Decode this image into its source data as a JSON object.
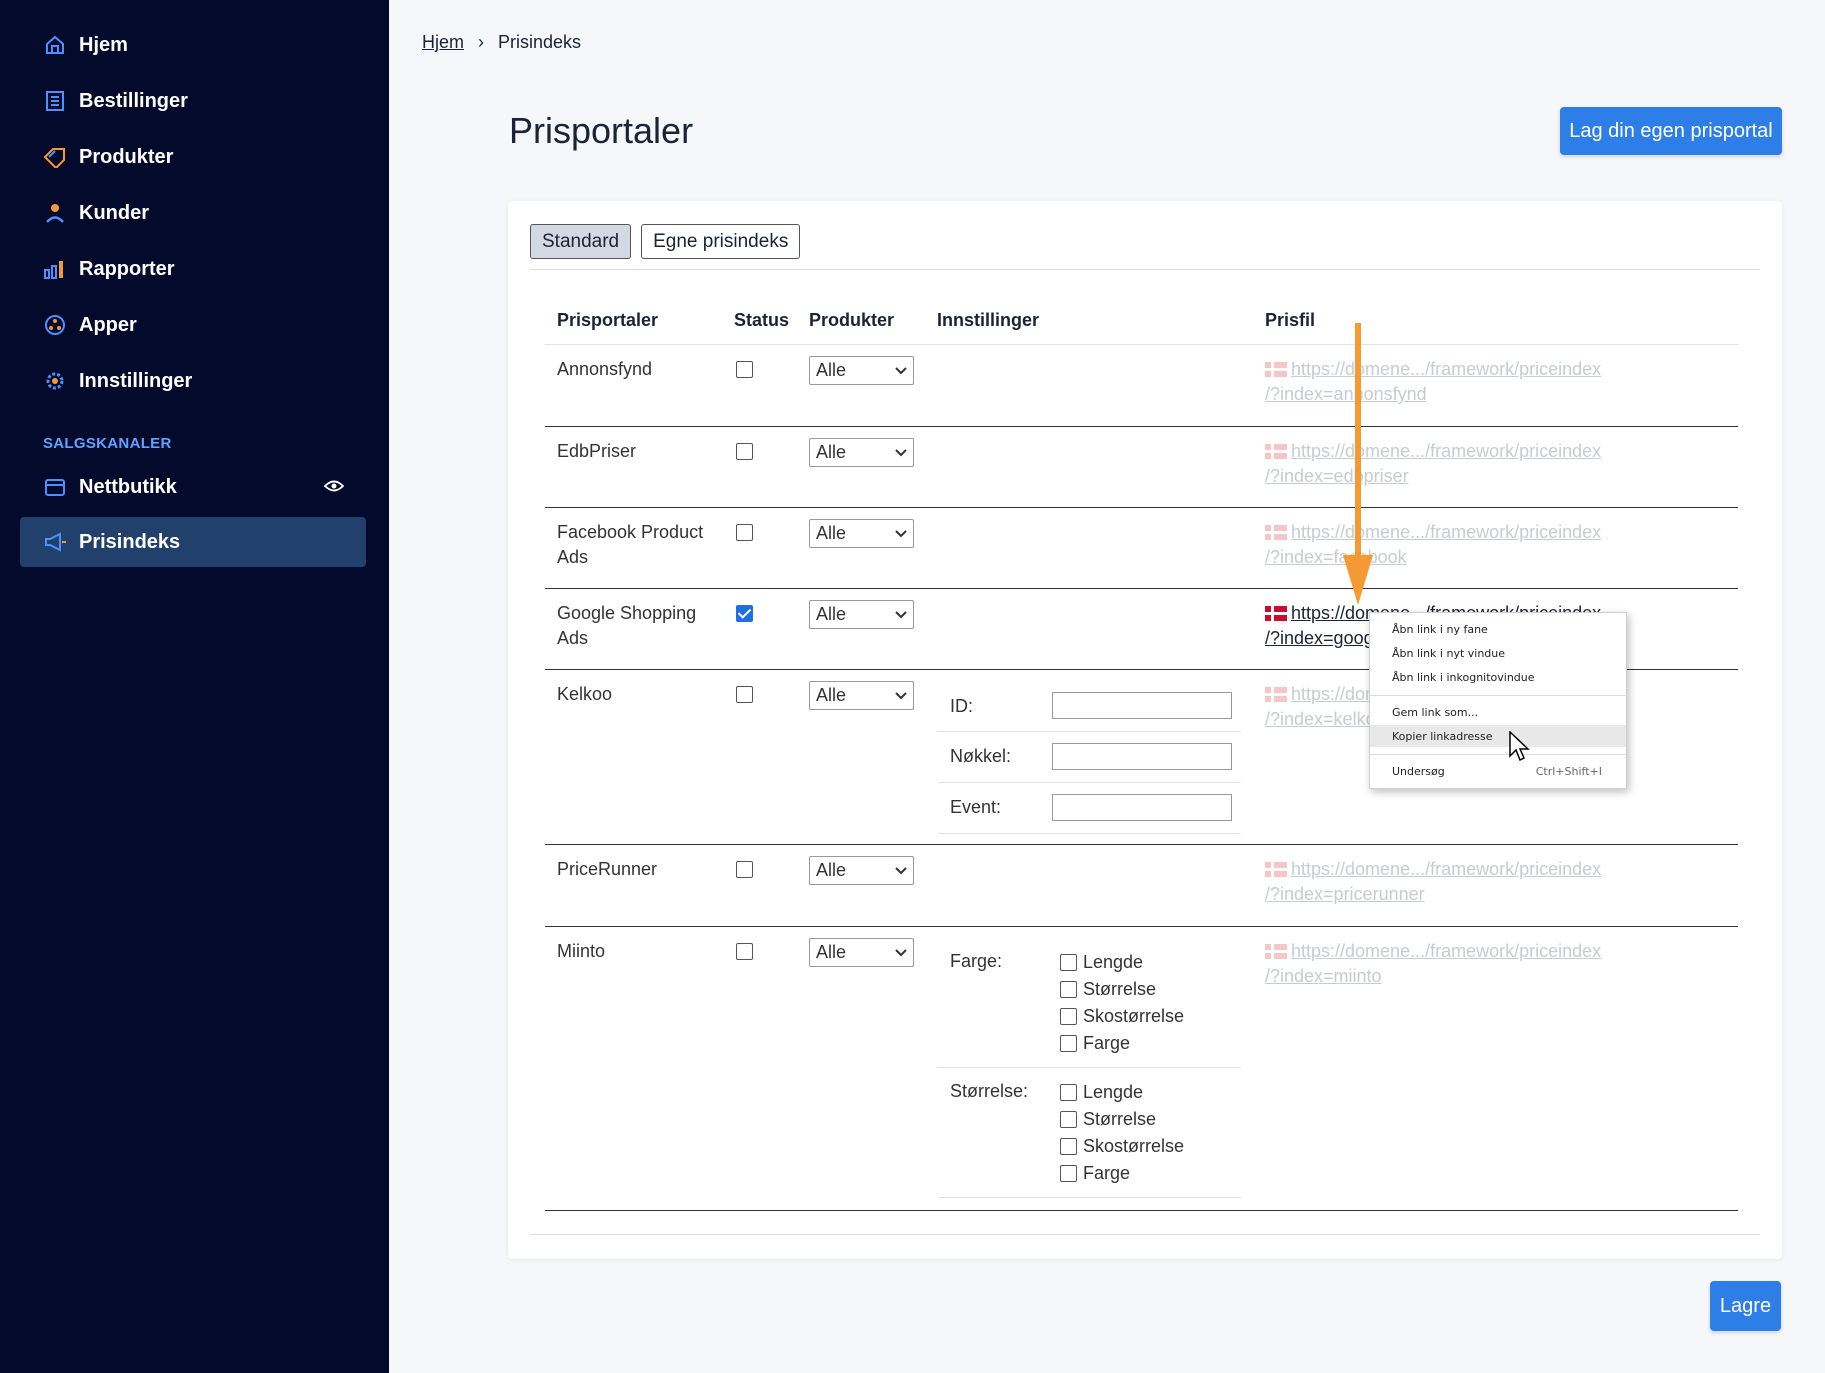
{
  "sidebar": {
    "items": [
      {
        "label": "Hjem",
        "icon": "home-icon"
      },
      {
        "label": "Bestillinger",
        "icon": "orders-icon"
      },
      {
        "label": "Produkter",
        "icon": "tag-icon"
      },
      {
        "label": "Kunder",
        "icon": "user-icon"
      },
      {
        "label": "Rapporter",
        "icon": "bar-chart-icon"
      },
      {
        "label": "Apper",
        "icon": "apps-icon"
      },
      {
        "label": "Innstillinger",
        "icon": "gear-icon"
      }
    ],
    "section_title": "SALGSKANALER",
    "channels": [
      {
        "label": "Nettbutikk",
        "icon": "store-icon"
      },
      {
        "label": "Prisindeks",
        "icon": "megaphone-icon",
        "active": true
      }
    ]
  },
  "breadcrumb": {
    "home": "Hjem",
    "separator": "›",
    "current": "Prisindeks"
  },
  "page": {
    "title": "Prisportaler",
    "create_button": "Lag din egen prisportal",
    "save_button": "Lagre"
  },
  "tabs": [
    {
      "label": "Standard",
      "active": true
    },
    {
      "label": "Egne prisindeks",
      "active": false
    }
  ],
  "table": {
    "headers": {
      "portal": "Prisportaler",
      "status": "Status",
      "products": "Produkter",
      "settings": "Innstillinger",
      "file": "Prisfil"
    },
    "rows": [
      {
        "name": "Annonsfynd",
        "checked": false,
        "products": "Alle",
        "link1": "https://domene.../framework/priceindex",
        "link2": "/?index=annonsfynd"
      },
      {
        "name": "EdbPriser",
        "checked": false,
        "products": "Alle",
        "link1": "https://domene.../framework/priceindex",
        "link2": "/?index=edbpriser"
      },
      {
        "name": "Facebook Product Ads",
        "checked": false,
        "products": "Alle",
        "link1": "https://domene.../framework/priceindex",
        "link2": "/?index=facebook"
      },
      {
        "name": "Google Shopping Ads",
        "checked": true,
        "products": "Alle",
        "link1": "https://domene.../framework/priceindex",
        "link2": "/?index=google"
      },
      {
        "name": "Kelkoo",
        "checked": false,
        "products": "Alle",
        "link1": "https://domene.../framework/priceindex",
        "link2": "/?index=kelkoo",
        "settings": [
          {
            "label": "ID:",
            "value": ""
          },
          {
            "label": "Nøkkel:",
            "value": ""
          },
          {
            "label": "Event:",
            "value": ""
          }
        ]
      },
      {
        "name": "PriceRunner",
        "checked": false,
        "products": "Alle",
        "link1": "https://domene.../framework/priceindex",
        "link2": "/?index=pricerunner"
      },
      {
        "name": "Miinto",
        "checked": false,
        "products": "Alle",
        "link1": "https://domene.../framework/priceindex",
        "link2": "/?index=miinto",
        "groups": [
          {
            "label": "Farge:",
            "options": [
              "Lengde",
              "Størrelse",
              "Skostørrelse",
              "Farge"
            ]
          },
          {
            "label": "Størrelse:",
            "options": [
              "Lengde",
              "Størrelse",
              "Skostørrelse",
              "Farge"
            ]
          }
        ]
      }
    ]
  },
  "context_menu": {
    "items": [
      "Åbn link i ny fane",
      "Åbn link i nyt vindue",
      "Åbn link i inkognitovindue",
      "Gem link som...",
      "Kopier linkadresse",
      "Undersøg"
    ],
    "shortcut": "Ctrl+Shift+I",
    "highlighted": "Kopier linkadresse"
  },
  "colors": {
    "sidebar": "#040a2c",
    "accent": "#2d7ee7",
    "active_nav": "#22406c",
    "section": "#5fa2ff",
    "arrow": "#f39a35"
  }
}
